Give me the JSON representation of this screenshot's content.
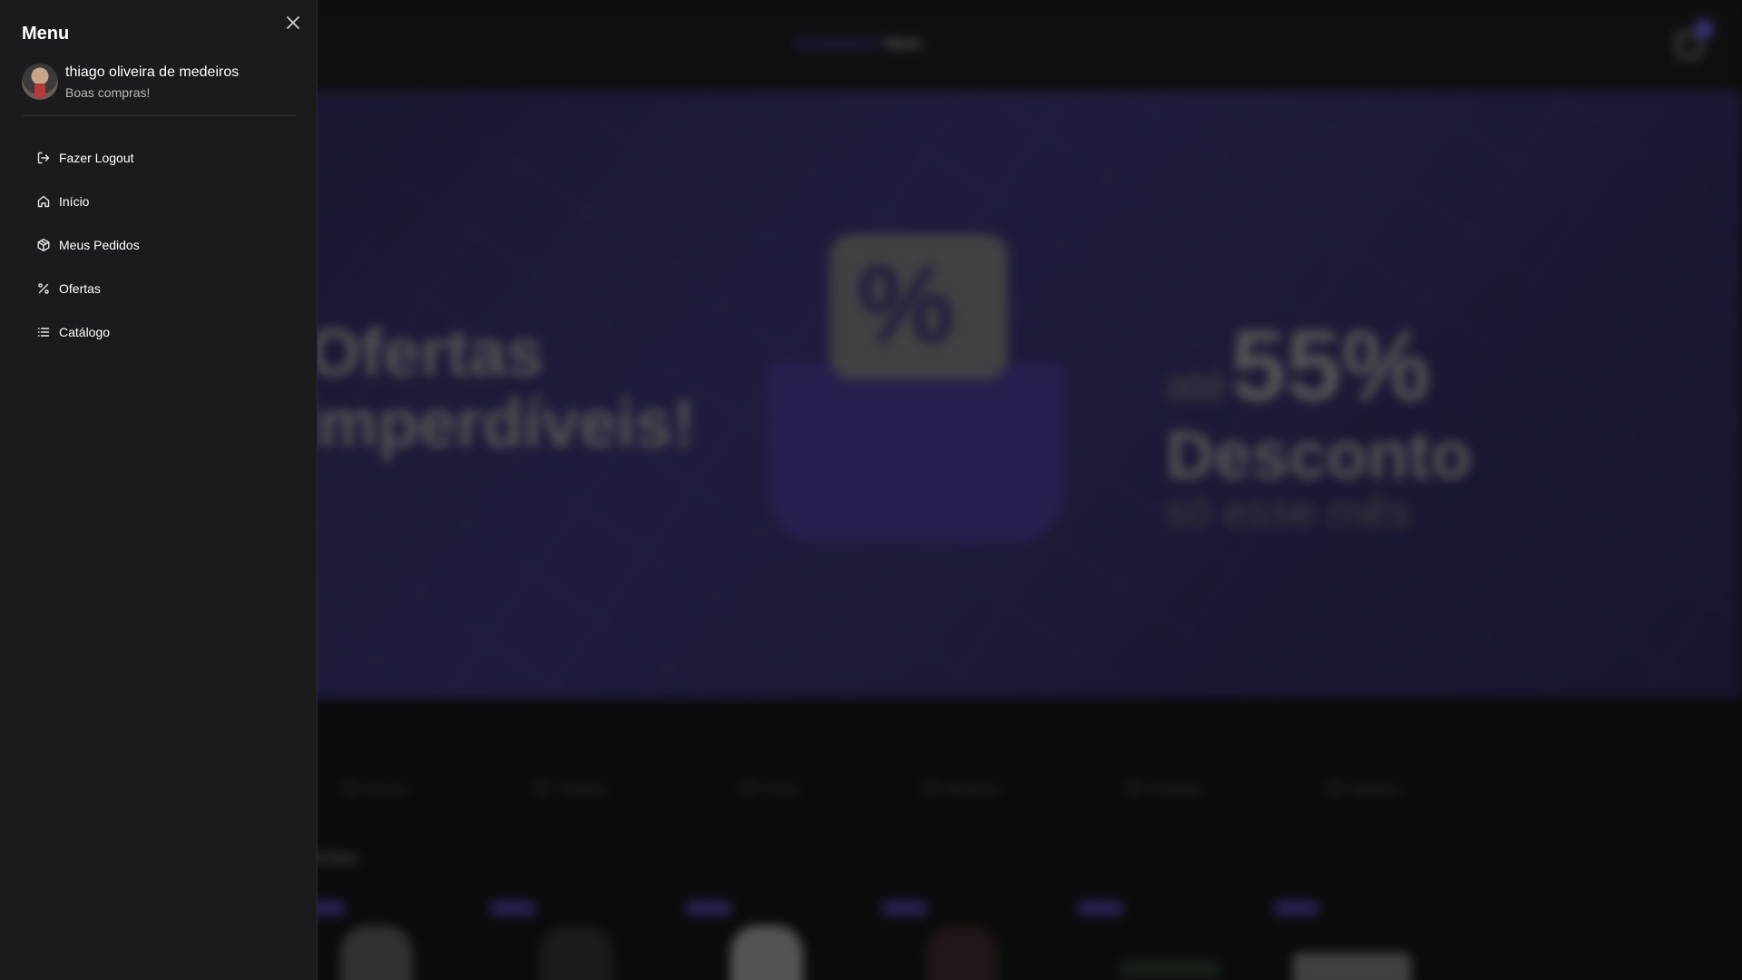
{
  "drawer": {
    "title": "Menu",
    "user": {
      "name": "thiago oliveira de medeiros",
      "greeting": "Boas compras!"
    },
    "items": [
      {
        "label": "Fazer Logout",
        "icon": "logout-icon"
      },
      {
        "label": "Início",
        "icon": "home-icon"
      },
      {
        "label": "Meus Pedidos",
        "icon": "package-icon"
      },
      {
        "label": "Ofertas",
        "icon": "percent-icon"
      },
      {
        "label": "Catálogo",
        "icon": "list-icon"
      }
    ]
  },
  "background": {
    "brand_part1": "Ecommerce",
    "brand_part2": "Store",
    "banner": {
      "left_line1": "Ofertas",
      "left_line2": "Imperdíveis!",
      "percent_symbol": "%",
      "right_pre": "até",
      "right_big": "55%",
      "right_desc": "Desconto",
      "right_post": "só esse mês"
    },
    "categories": [
      "Mouses",
      "Teclados",
      "Fones",
      "Monitores",
      "Headsets",
      "Speakers"
    ],
    "section_title": "Ofertas"
  },
  "colors": {
    "accent": "#6c5ce7",
    "drawer_bg": "#1b1b1d",
    "page_bg": "#151515"
  }
}
